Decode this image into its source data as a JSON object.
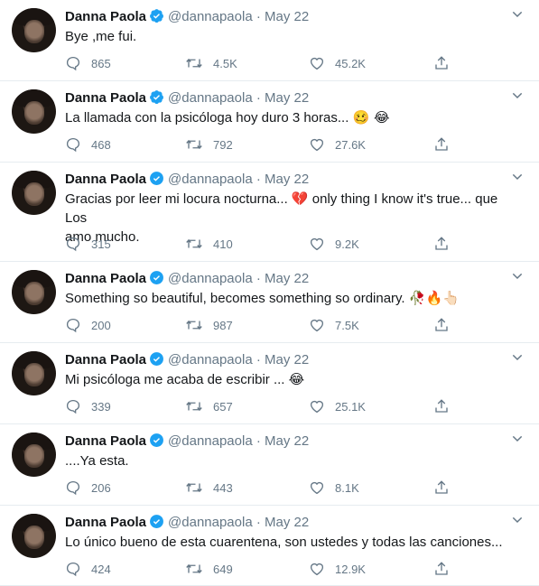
{
  "tweets": [
    {
      "name": "Danna Paola",
      "handle": "@dannapaola",
      "sep": "·",
      "date": "May 22",
      "text": "Bye ,me fui.",
      "emoji": "",
      "replies": "865",
      "retweets": "4.5K",
      "likes": "45.2K"
    },
    {
      "name": "Danna Paola",
      "handle": "@dannapaola",
      "sep": "·",
      "date": "May 22",
      "text": "La llamada con la psicóloga hoy duro 3 horas... ",
      "emoji": "🥴 😂",
      "replies": "468",
      "retweets": "792",
      "likes": "27.6K"
    },
    {
      "name": "Danna Paola",
      "handle": "@dannapaola",
      "sep": "·",
      "date": "May 22",
      "text": "Gracias por leer mi locura nocturna... 💔 only thing I know it's true... que Los\namo mucho.",
      "emoji": "",
      "replies": "315",
      "retweets": "410",
      "likes": "9.2K"
    },
    {
      "name": "Danna Paola",
      "handle": "@dannapaola",
      "sep": "·",
      "date": "May 22",
      "text": "Something so beautiful, becomes something so ordinary. ",
      "emoji": "🥀🔥👆🏻",
      "replies": "200",
      "retweets": "987",
      "likes": "7.5K"
    },
    {
      "name": "Danna Paola",
      "handle": "@dannapaola",
      "sep": "·",
      "date": "May 22",
      "text": "Mi psicóloga me acaba de escribir ... ",
      "emoji": "😂",
      "replies": "339",
      "retweets": "657",
      "likes": "25.1K"
    },
    {
      "name": "Danna Paola",
      "handle": "@dannapaola",
      "sep": "·",
      "date": "May 22",
      "text": "....Ya esta.",
      "emoji": "",
      "replies": "206",
      "retweets": "443",
      "likes": "8.1K"
    },
    {
      "name": "Danna Paola",
      "handle": "@dannapaola",
      "sep": "·",
      "date": "May 22",
      "text": "Lo único bueno de esta cuarentena, son ustedes y todas las canciones...",
      "emoji": "",
      "replies": "424",
      "retweets": "649",
      "likes": "12.9K"
    }
  ],
  "colors": {
    "accent": "#1da1f2",
    "muted": "#657786",
    "text": "#14171a",
    "divider": "#e6ecf0"
  },
  "icons": {
    "reply": "reply-icon",
    "retweet": "retweet-icon",
    "like": "heart-icon",
    "share": "share-icon",
    "verified": "verified-badge-icon",
    "menu": "chevron-down-icon"
  }
}
